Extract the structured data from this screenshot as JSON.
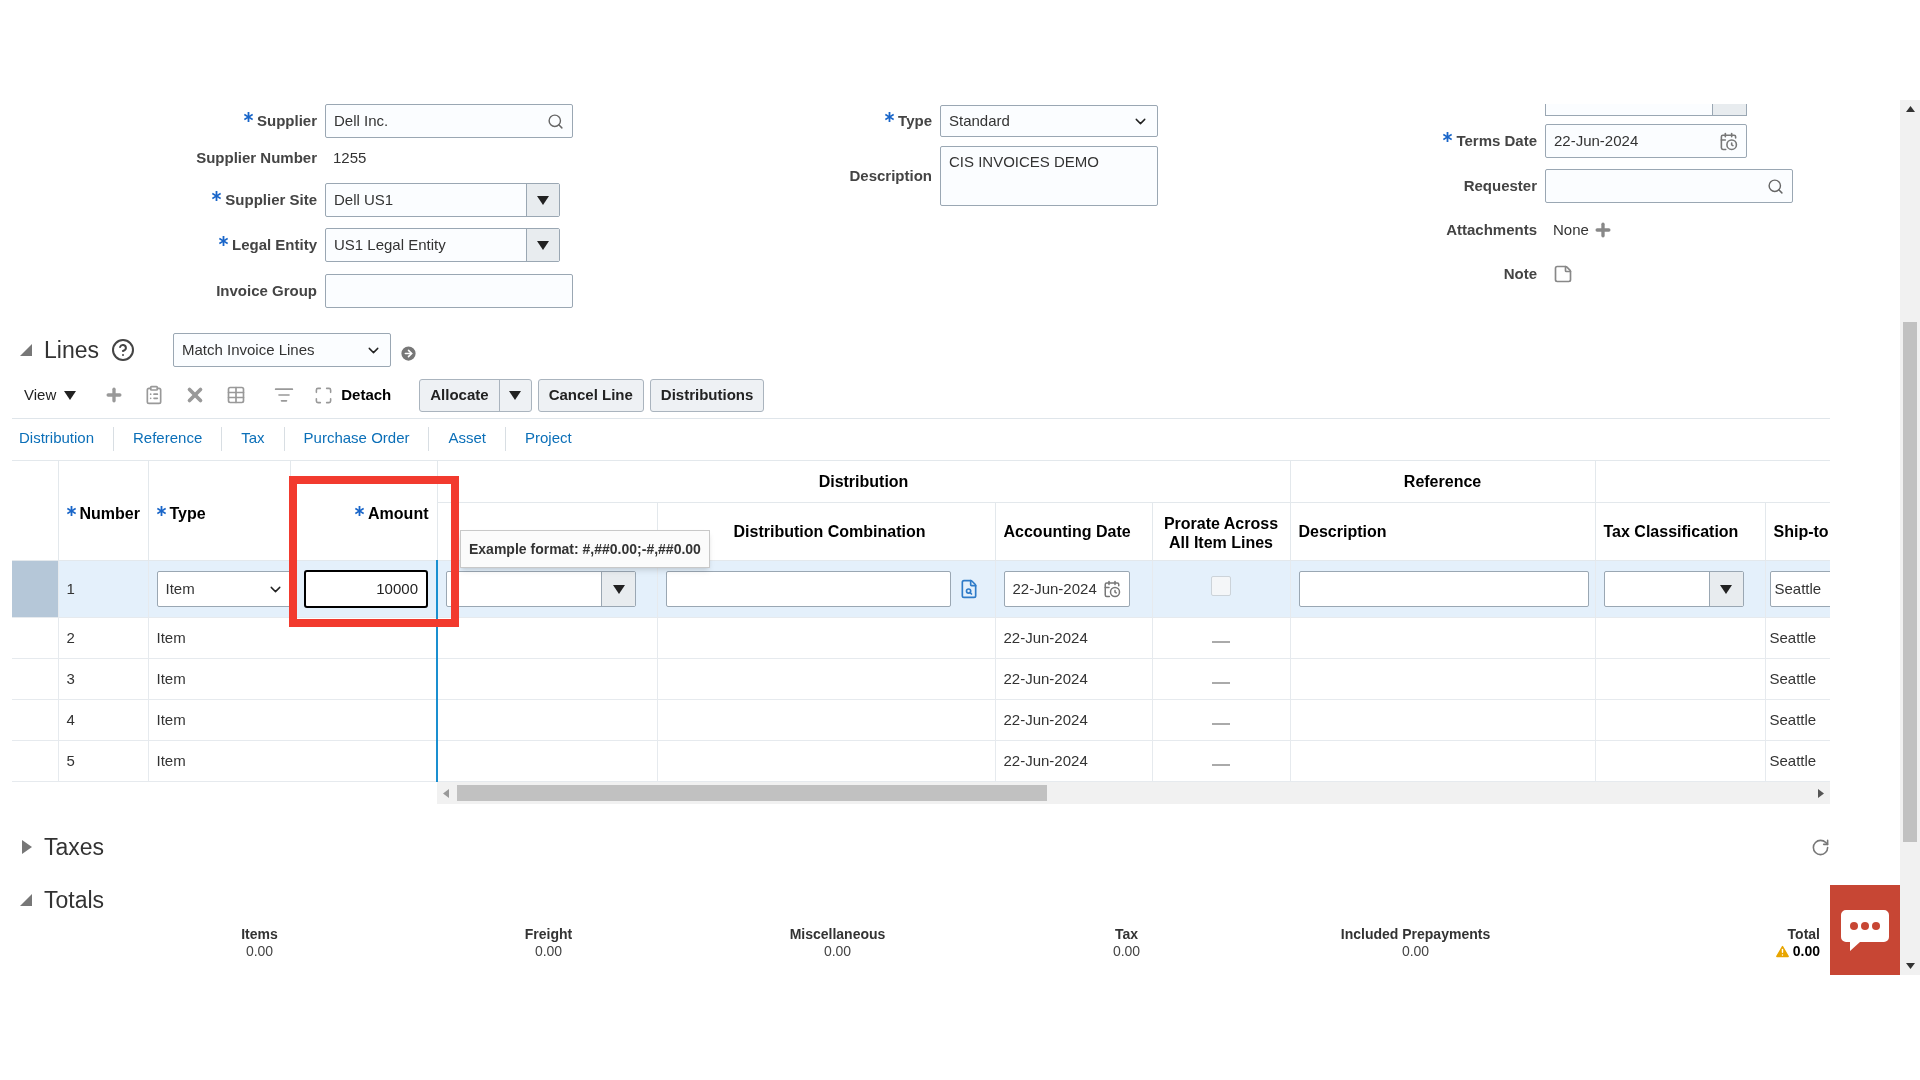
{
  "form": {
    "left": [
      {
        "label": "Supplier",
        "required": true,
        "kind": "search",
        "value": "Dell Inc."
      },
      {
        "label": "Supplier Number",
        "required": false,
        "kind": "text",
        "value": "1255"
      },
      {
        "label": "Supplier Site",
        "required": true,
        "kind": "select",
        "value": "Dell US1"
      },
      {
        "label": "Legal Entity",
        "required": true,
        "kind": "select",
        "value": "US1 Legal Entity"
      },
      {
        "label": "Invoice Group",
        "required": false,
        "kind": "input"
      }
    ],
    "middle": [
      {
        "label": "Type",
        "required": true,
        "kind": "choice",
        "value": "Standard"
      },
      {
        "label": "Description",
        "required": false,
        "kind": "textarea",
        "value": "CIS INVOICES DEMO"
      }
    ],
    "right": [
      {
        "label": "Terms Date",
        "required": true,
        "kind": "date",
        "value": "22-Jun-2024"
      },
      {
        "label": "Requester",
        "required": false,
        "kind": "search"
      },
      {
        "label": "Attachments",
        "required": false,
        "kind": "attachments",
        "value": "None"
      },
      {
        "label": "Note",
        "required": false,
        "kind": "note"
      }
    ]
  },
  "lines": {
    "title": "Lines",
    "expanded": true,
    "match_select": "Match Invoice Lines",
    "toolbar": {
      "view": "View",
      "detach": "Detach",
      "buttons": [
        {
          "label": "Allocate",
          "kind": "split"
        },
        {
          "label": "Cancel Line",
          "kind": "plain"
        },
        {
          "label": "Distributions",
          "kind": "plain"
        }
      ]
    },
    "tabs": [
      {
        "label": "Distribution",
        "selected": false
      },
      {
        "label": "Reference",
        "selected": false
      },
      {
        "label": "Tax",
        "selected": false
      },
      {
        "label": "Purchase Order",
        "selected": false
      },
      {
        "label": "Asset",
        "selected": false
      },
      {
        "label": "Project",
        "selected": false
      }
    ],
    "table": {
      "group_headers": [
        "Distribution",
        "Reference"
      ],
      "columns": [
        {
          "label": "Number",
          "required": true
        },
        {
          "label": "Type",
          "required": true
        },
        {
          "label": "Amount",
          "required": true
        },
        {
          "label": "Distribution Combination",
          "required": false
        },
        {
          "label": "Accounting Date",
          "required": false
        },
        {
          "label": "Prorate Across All Item Lines",
          "required": false
        },
        {
          "label": "Description",
          "required": false
        },
        {
          "label": "Tax Classification",
          "required": false
        },
        {
          "label": "Ship-to",
          "required": false
        }
      ],
      "rows": [
        {
          "number": "1",
          "type": "Item",
          "amount": "10000",
          "accounting_date": "22-Jun-2024",
          "prorate": false,
          "ship_to": "Seattle",
          "selected": true
        },
        {
          "number": "2",
          "type": "Item",
          "accounting_date": "22-Jun-2024",
          "prorate": false,
          "ship_to": "Seattle",
          "selected": false
        },
        {
          "number": "3",
          "type": "Item",
          "accounting_date": "22-Jun-2024",
          "prorate": false,
          "ship_to": "Seattle",
          "selected": false
        },
        {
          "number": "4",
          "type": "Item",
          "accounting_date": "22-Jun-2024",
          "prorate": false,
          "ship_to": "Seattle",
          "selected": false
        },
        {
          "number": "5",
          "type": "Item",
          "accounting_date": "22-Jun-2024",
          "prorate": false,
          "ship_to": "Seattle",
          "selected": false
        }
      ],
      "tooltip": "Example format: #,##0.00;-#,##0.00"
    }
  },
  "taxes": {
    "title": "Taxes",
    "expanded": false
  },
  "totals": {
    "title": "Totals",
    "expanded": true,
    "items": [
      {
        "label": "Items",
        "value": "0.00",
        "warning": false
      },
      {
        "label": "Freight",
        "value": "0.00",
        "warning": false
      },
      {
        "label": "Miscellaneous",
        "value": "0.00",
        "warning": false
      },
      {
        "label": "Tax",
        "value": "0.00",
        "warning": false
      },
      {
        "label": "Included Prepayments",
        "value": "0.00",
        "warning": false
      },
      {
        "label": "Total",
        "value": "0.00",
        "warning": true
      }
    ]
  }
}
